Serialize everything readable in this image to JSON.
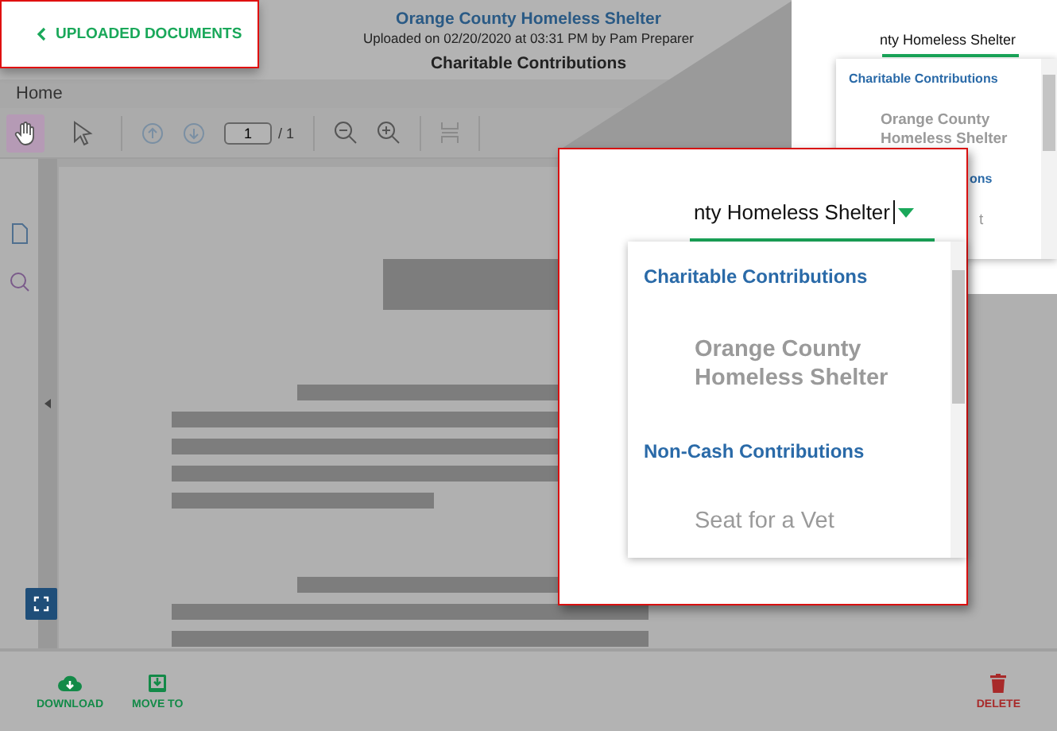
{
  "back_link": {
    "label": "UPLOADED DOCUMENTS"
  },
  "header": {
    "title": "Orange County Homeless Shelter",
    "subtitle": "Uploaded on 02/20/2020 at 03:31 PM by Pam Preparer",
    "category": "Charitable Contributions"
  },
  "tabs": [
    {
      "label": "Home"
    }
  ],
  "toolbar": {
    "tools": [
      {
        "kind": "hand",
        "selected": true
      },
      {
        "kind": "pointer",
        "selected": false
      }
    ],
    "page": "1",
    "page_total": "/ 1"
  },
  "actions": [
    {
      "kind": "download",
      "label": "DOWNLOAD"
    },
    {
      "kind": "move",
      "label": "MOVE TO"
    },
    {
      "kind": "delete",
      "label": "DELETE"
    }
  ],
  "category_panel": {
    "value": "nty Homeless Shelter",
    "options": [
      {
        "kind": "heading",
        "text": "Charitable Contributions"
      },
      {
        "kind": "option",
        "text": "Orange County Homeless Shelter"
      },
      {
        "kind": "heading-fragment",
        "text": "ons"
      },
      {
        "kind": "option-fragment",
        "text": "t"
      }
    ]
  },
  "zoom_callout": {
    "value": "nty Homeless Shelter",
    "options": [
      {
        "kind": "heading",
        "text": "Charitable Contributions"
      },
      {
        "kind": "option",
        "text": "Orange County Homeless Shelter"
      },
      {
        "kind": "heading",
        "text": "Non-Cash Contributions"
      },
      {
        "kind": "option",
        "text": "Seat for a Vet"
      }
    ]
  }
}
